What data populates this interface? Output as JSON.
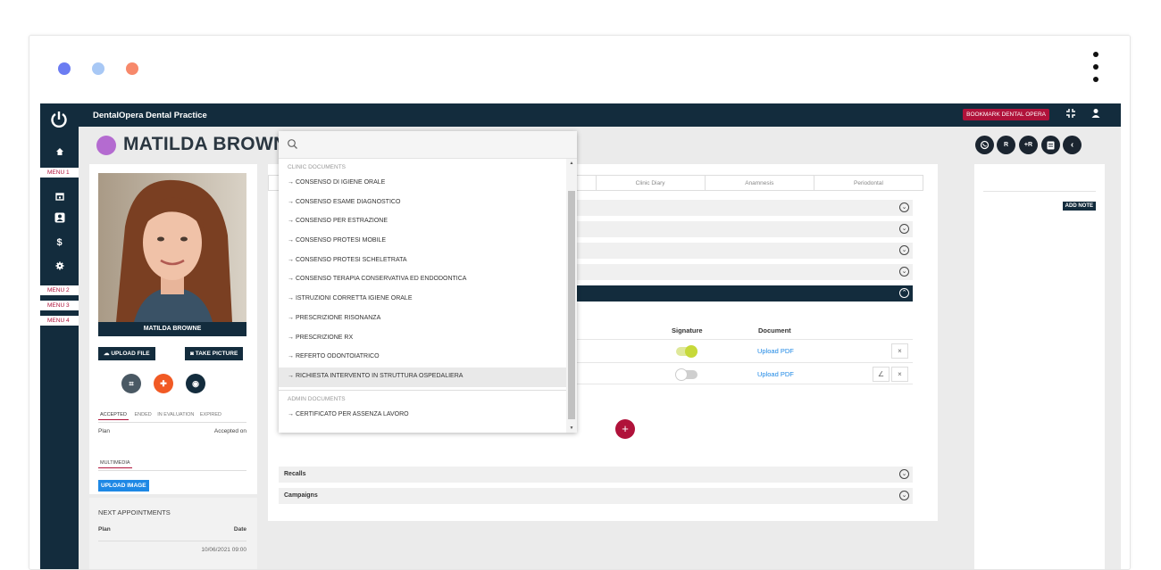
{
  "window": {
    "dot_colors": [
      "#6b7cf2",
      "#a8c8f5",
      "#f7896b"
    ]
  },
  "topbar": {
    "app_title": "DentalOpera Dental Practice",
    "bookmark_label": "BOOKMARK DENTAL OPERA",
    "icons": [
      "compress-icon",
      "user-icon"
    ]
  },
  "sidebar": {
    "menu1": "MENU 1",
    "menu2": "MENU 2",
    "menu3": "MENU 3",
    "menu4": "MENU 4",
    "icons": [
      "home-icon",
      "calendar-icon",
      "user-circle-icon",
      "dollar-icon",
      "gear-icon"
    ]
  },
  "patient": {
    "name": "MATILDA BROWNE",
    "photo_caption": "MATILDA BROWNE",
    "avatar_color": "#b46bd0"
  },
  "header_actions": {
    "whatsapp": "",
    "rx": "R",
    "plus_r": "+R",
    "doc": "",
    "back": "‹"
  },
  "left_panel": {
    "upload_file": "UPLOAD FILE",
    "take_picture": "TAKE PICTURE",
    "tabs": [
      "ACCEPTED",
      "ENDED",
      "IN EVALUATION",
      "EXPIRED"
    ],
    "plan_label": "Plan",
    "accepted_on_label": "Accepted on",
    "multimedia_label": "MULTIMEDIA",
    "upload_image": "UPLOAD IMAGE"
  },
  "appointments": {
    "title": "NEXT APPOINTMENTS",
    "plan_label": "Plan",
    "date_label": "Date",
    "rows": [
      {
        "date": "10/06/2021 09:00"
      }
    ]
  },
  "main": {
    "tabs": [
      "Clinic Diary",
      "Anamnesis",
      "Periodontal"
    ],
    "doc_table": {
      "signature_header": "Signature",
      "document_header": "Document",
      "rows": [
        {
          "signed": true,
          "document": "Upload PDF"
        },
        {
          "signed": false,
          "document": "Upload PDF"
        }
      ]
    },
    "recalls": "Recalls",
    "campaigns": "Campaigns"
  },
  "right_panel": {
    "add_note": "ADD NOTE"
  },
  "dropdown": {
    "search_placeholder": "",
    "group_clinic": "CLINIC DOCUMENTS",
    "clinic_items": [
      "→ CONSENSO DI IGIENE ORALE",
      "→ CONSENSO ESAME DIAGNOSTICO",
      "→ CONSENSO PER ESTRAZIONE",
      "→ CONSENSO PROTESI MOBILE",
      "→ CONSENSO PROTESI SCHELETRATA",
      "→ CONSENSO TERAPIA CONSERVATIVA ED ENDODONTICA",
      "→ ISTRUZIONI CORRETTA IGIENE ORALE",
      "→ PRESCRIZIONE RISONANZA",
      "→ PRESCRIZIONE RX",
      "→ REFERTO ODONTOIATRICO",
      "→ RICHIESTA INTERVENTO IN STRUTTURA OSPEDALIERA"
    ],
    "group_admin": "ADMIN DOCUMENTS",
    "admin_items": [
      "→ CERTIFICATO PER ASSENZA LAVORO"
    ]
  },
  "colors": {
    "navy": "#132c3d",
    "accent_red": "#b0123a",
    "link_blue": "#1e88e5",
    "toggle_on": "#c7d93a"
  }
}
